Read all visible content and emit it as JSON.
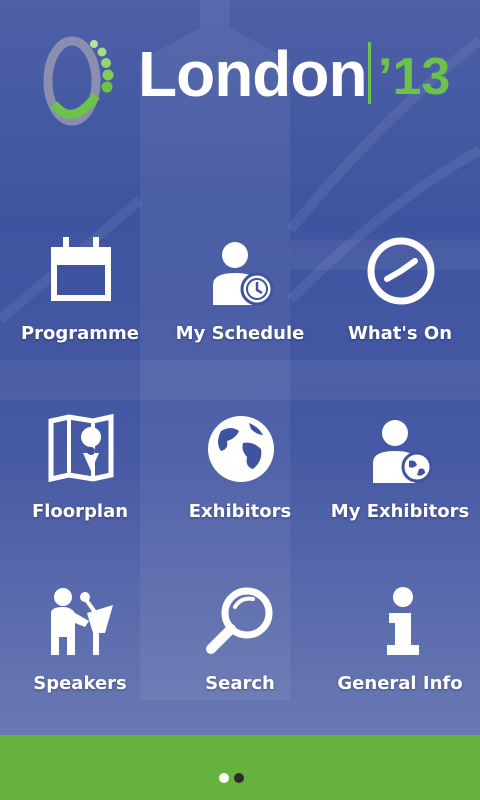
{
  "header": {
    "logo_text": "London",
    "logo_year": "’13"
  },
  "menu": [
    {
      "label": "Programme",
      "icon": "calendar-icon"
    },
    {
      "label": "My Schedule",
      "icon": "person-clock-icon"
    },
    {
      "label": "What's On",
      "icon": "clock-icon"
    },
    {
      "label": "Floorplan",
      "icon": "map-pin-icon"
    },
    {
      "label": "Exhibitors",
      "icon": "globe-icon"
    },
    {
      "label": "My Exhibitors",
      "icon": "person-globe-icon"
    },
    {
      "label": "Speakers",
      "icon": "speaker-podium-icon"
    },
    {
      "label": "Search",
      "icon": "magnifier-icon"
    },
    {
      "label": "General Info",
      "icon": "info-icon"
    }
  ],
  "pager": {
    "current_page": 1,
    "page_count": 2
  },
  "colors": {
    "brand_blue": "#4358a3",
    "brand_green": "#66b23e"
  }
}
